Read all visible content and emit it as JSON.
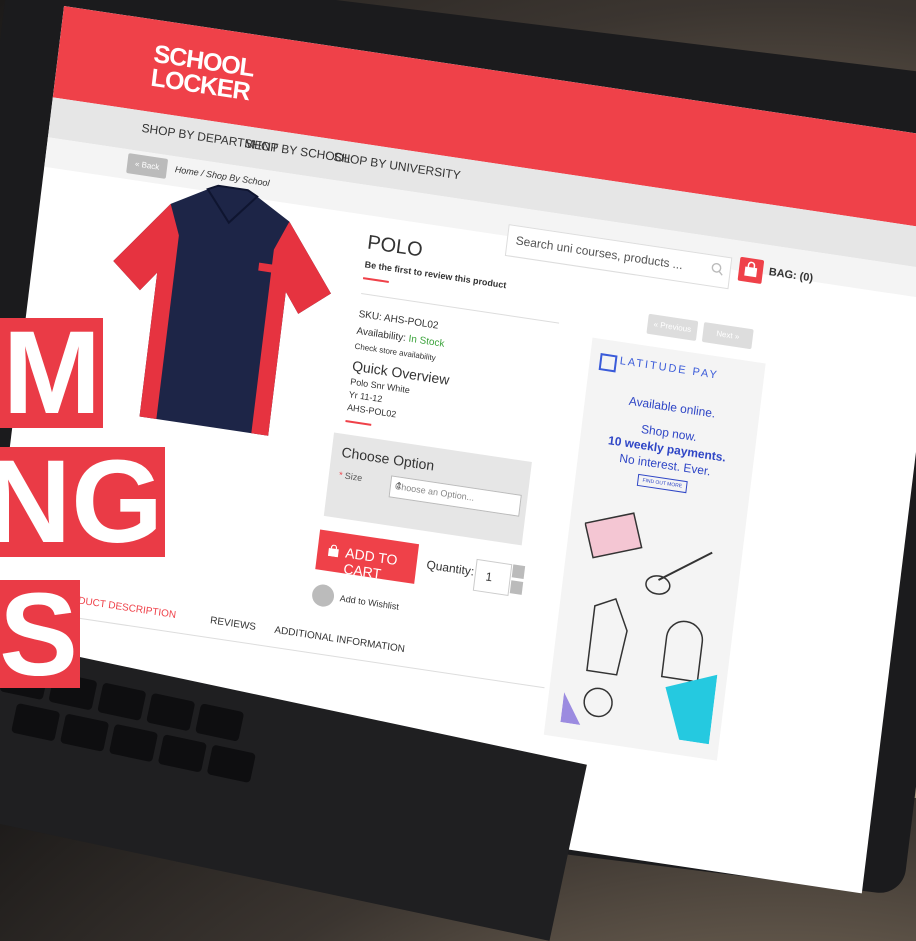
{
  "header": {
    "logo_line1": "SCHOOL",
    "logo_line2": "LOCKER",
    "brand_color": "#ef4149"
  },
  "nav": {
    "items": [
      "SHOP BY DEPARTMENT",
      "SHOP BY SCHOOL",
      "SHOP BY UNIVERSITY"
    ]
  },
  "breadcrumb": {
    "back_label": "« Back",
    "path": "Home / Shop By School"
  },
  "search": {
    "placeholder": "Search uni courses, products ...",
    "icon": "search-icon"
  },
  "bag": {
    "label": "BAG: (0)",
    "icon": "shopping-bag-icon"
  },
  "product": {
    "title": "POLO",
    "review_prompt": "Be the first to review this product",
    "sku": "SKU: AHS-POL02",
    "availability_label": "Availability:",
    "availability_value": "In Stock",
    "store_check": "Check store availability",
    "quick_overview_title": "Quick Overview",
    "quick_overview_lines": [
      "Polo Snr White",
      "Yr 11-12",
      "AHS-POL02"
    ]
  },
  "pager": {
    "previous": "« Previous",
    "next": "Next »"
  },
  "options": {
    "title": "Choose Option",
    "size_required_marker": "*",
    "size_label": "Size",
    "size_placeholder": "Choose an Option..."
  },
  "cart": {
    "button_label": "ADD TO CART",
    "quantity_label": "Quantity:",
    "quantity_value": "1",
    "wishlist_label": "Add to Wishlist"
  },
  "tabs": [
    "PRODUCT DESCRIPTION",
    "REVIEWS",
    "ADDITIONAL INFORMATION"
  ],
  "ad": {
    "brand": "LATITUDE PAY",
    "line1": "Available online.",
    "line2": "Shop now.",
    "line3": "10 weekly payments.",
    "line4": "No interest. Ever.",
    "cta": "FIND OUT MORE",
    "accent_color": "#2f46c6"
  },
  "overlay_text": [
    "M",
    "NG",
    "S"
  ]
}
